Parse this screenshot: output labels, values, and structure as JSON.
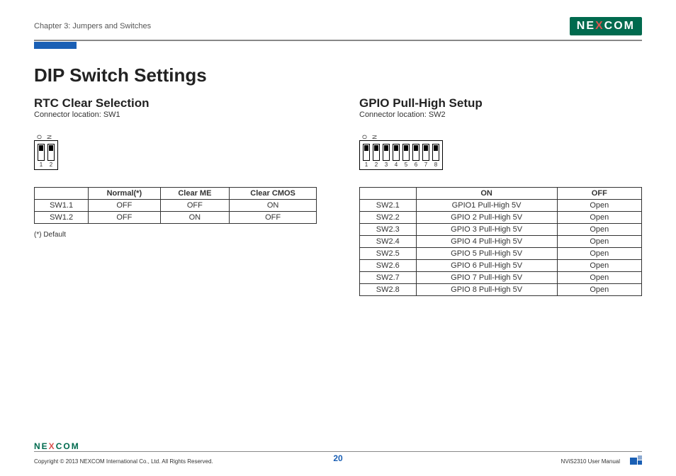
{
  "header": {
    "chapter": "Chapter 3: Jumpers and Switches",
    "logo_pre": "NE",
    "logo_x": "X",
    "logo_post": "COM"
  },
  "title": "DIP Switch Settings",
  "left": {
    "heading": "RTC Clear Selection",
    "connector": "Connector location: SW1",
    "dip_o": "O",
    "dip_n": "N",
    "nums": [
      "1",
      "2"
    ],
    "table": {
      "headers": [
        "",
        "Normal(*)",
        "Clear ME",
        "Clear CMOS"
      ],
      "rows": [
        [
          "SW1.1",
          "OFF",
          "OFF",
          "ON"
        ],
        [
          "SW1.2",
          "OFF",
          "ON",
          "OFF"
        ]
      ]
    },
    "footnote": "(*) Default"
  },
  "right": {
    "heading": "GPIO Pull-High Setup",
    "connector": "Connector location: SW2",
    "dip_o": "O",
    "dip_n": "N",
    "nums": [
      "1",
      "2",
      "3",
      "4",
      "5",
      "6",
      "7",
      "8"
    ],
    "table": {
      "headers": [
        "",
        "ON",
        "OFF"
      ],
      "rows": [
        [
          "SW2.1",
          "GPIO1 Pull-High 5V",
          "Open"
        ],
        [
          "SW2.2",
          "GPIO 2 Pull-High 5V",
          "Open"
        ],
        [
          "SW2.3",
          "GPIO 3 Pull-High 5V",
          "Open"
        ],
        [
          "SW2.4",
          "GPIO 4 Pull-High 5V",
          "Open"
        ],
        [
          "SW2.5",
          "GPIO 5 Pull-High 5V",
          "Open"
        ],
        [
          "SW2.6",
          "GPIO 6 Pull-High 5V",
          "Open"
        ],
        [
          "SW2.7",
          "GPIO 7 Pull-High 5V",
          "Open"
        ],
        [
          "SW2.8",
          "GPIO 8 Pull-High 5V",
          "Open"
        ]
      ]
    }
  },
  "footer": {
    "logo_pre": "NE",
    "logo_x": "X",
    "logo_post": "COM",
    "copyright": "Copyright © 2013 NEXCOM International Co., Ltd. All Rights Reserved.",
    "page": "20",
    "manual": "NViS2310 User Manual"
  }
}
